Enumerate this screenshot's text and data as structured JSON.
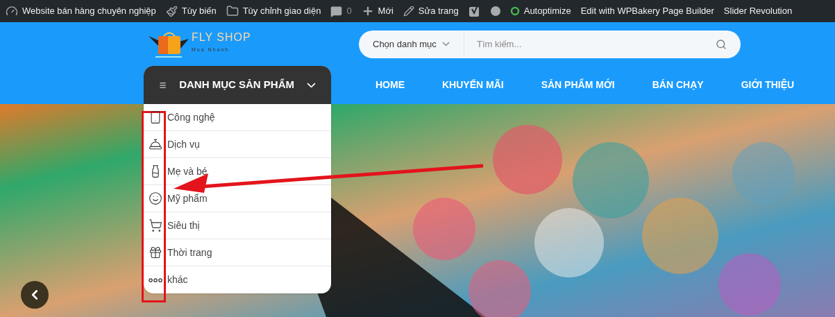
{
  "admin_bar": {
    "site": "Website bán hàng chuyên nghiệp",
    "customize": "Tùy biến",
    "themes": "Tùy chỉnh giao diện",
    "comments": "0",
    "new": "Mới",
    "edit": "Sửa trang",
    "autoptimize": "Autoptimize",
    "wpbakery": "Edit with WPBakery Page Builder",
    "slider": "Slider Revolution"
  },
  "logo": {
    "name": "FLY SHOP",
    "tagline": "Mua Nhanh"
  },
  "search": {
    "category": "Chọn danh mục",
    "placeholder": "Tìm kiếm..."
  },
  "category_menu": {
    "title": "DANH MỤC SẢN PHẨM",
    "expanded": true,
    "items": [
      {
        "label": "Công nghệ"
      },
      {
        "label": "Dịch vụ"
      },
      {
        "label": "Mẹ và bé"
      },
      {
        "label": "Mỹ phẩm"
      },
      {
        "label": "Siêu thị"
      },
      {
        "label": "Thời trang"
      },
      {
        "label": "khác"
      }
    ]
  },
  "nav": [
    "HOME",
    "KHUYẾN MÃI",
    "SẢN PHẨM MỚI",
    "BÁN CHẠY",
    "GIỚI THIỆU"
  ]
}
